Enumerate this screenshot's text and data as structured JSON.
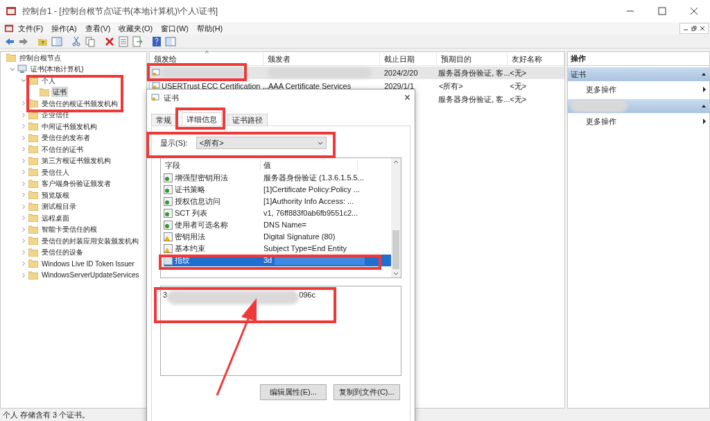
{
  "window": {
    "title": "控制台1 - [控制台根节点\\证书(本地计算机)\\个人\\证书]"
  },
  "menu": [
    "文件(F)",
    "操作(A)",
    "查看(V)",
    "收藏夹(O)",
    "窗口(W)",
    "帮助(H)"
  ],
  "tree": {
    "label": "控制台根节点",
    "children": [
      {
        "label": "证书(本地计算机)",
        "kind": "computer",
        "expanded": true,
        "children": [
          {
            "label": "个人",
            "expanded": true,
            "children": [
              {
                "label": "证书",
                "selected": true
              }
            ]
          },
          {
            "label": "受信任的根证书颁发机构",
            "expanded": false
          },
          {
            "label": "企业信任",
            "expanded": false
          },
          {
            "label": "中间证书颁发机构",
            "expanded": false
          },
          {
            "label": "受信任的发布者",
            "expanded": false
          },
          {
            "label": "不信任的证书",
            "expanded": false
          },
          {
            "label": "第三方根证书颁发机构",
            "expanded": false
          },
          {
            "label": "受信任人",
            "expanded": false
          },
          {
            "label": "客户端身份验证颁发者",
            "expanded": false
          },
          {
            "label": "预览版根",
            "expanded": false
          },
          {
            "label": "测试根目录",
            "expanded": false
          },
          {
            "label": "远程桌面",
            "expanded": false
          },
          {
            "label": "智能卡受信任的根",
            "expanded": false
          },
          {
            "label": "受信任的封装应用安装颁发机构",
            "expanded": false
          },
          {
            "label": "受信任的设备",
            "expanded": false
          },
          {
            "label": "Windows Live ID Token Issuer",
            "expanded": false
          },
          {
            "label": "WindowsServerUpdateServices",
            "expanded": false
          }
        ]
      }
    ]
  },
  "table": {
    "sort_mark": "^",
    "columns": [
      "颁发给",
      "颁发者",
      "截止日期",
      "预期目的",
      "友好名称"
    ],
    "rows": [
      {
        "selected": true,
        "expires": "2024/2/20",
        "purpose": "服务器身份验证, 客...",
        "friendly_name": "<无>"
      },
      {
        "selected": false,
        "issued_to": "USERTrust ECC Certification ...",
        "issuer": "AAA Certificate Services",
        "expires": "2029/1/1",
        "purpose": "<所有>",
        "friendly_name": "<无>"
      },
      {
        "selected": false,
        "purpose": "服务器身份验证, 客...",
        "friendly_name": "<无>"
      }
    ]
  },
  "actions": {
    "title": "操作",
    "sections": [
      {
        "title": "证书",
        "item": "更多操作"
      },
      {
        "item": "更多操作"
      }
    ]
  },
  "dialog": {
    "title": "证书",
    "close": "×",
    "tabs": [
      {
        "label": "常规",
        "selected": false
      },
      {
        "label": "详细信息",
        "selected": true
      },
      {
        "label": "证书路径",
        "selected": false
      }
    ],
    "show_label": "显示(S):",
    "show_value": "<所有>",
    "columns": [
      "字段",
      "值"
    ],
    "fields": [
      {
        "kind": "extension",
        "name": "增强型密钥用法",
        "value": "服务器身份验证 (1.3.6.1.5.5...",
        "selected": false
      },
      {
        "kind": "extension",
        "name": "证书策略",
        "value": "[1]Certificate Policy:Policy ...",
        "selected": false
      },
      {
        "kind": "extension",
        "name": "授权信息访问",
        "value": "[1]Authority Info Access: ...",
        "selected": false
      },
      {
        "kind": "extension",
        "name": "SCT 列表",
        "value": "v1, 76ff883f0ab6fb9551c2...",
        "selected": false
      },
      {
        "kind": "extension",
        "name": "使用者可选名称",
        "value": "DNS Name=",
        "selected": false
      },
      {
        "kind": "critical",
        "name": "密钥用法",
        "value": "Digital Signature (80)",
        "selected": false
      },
      {
        "kind": "critical",
        "name": "基本约束",
        "value": "Subject Type=End Entity",
        "selected": false
      },
      {
        "kind": "property",
        "name": "指纹",
        "value": "3d",
        "selected": true
      }
    ],
    "detail_start": "3",
    "detail_end": "096c",
    "buttons": [
      "编辑属性(E)...",
      "复制到文件(C)..."
    ]
  },
  "status_bar": "个人 存储含有 3 个证书。"
}
